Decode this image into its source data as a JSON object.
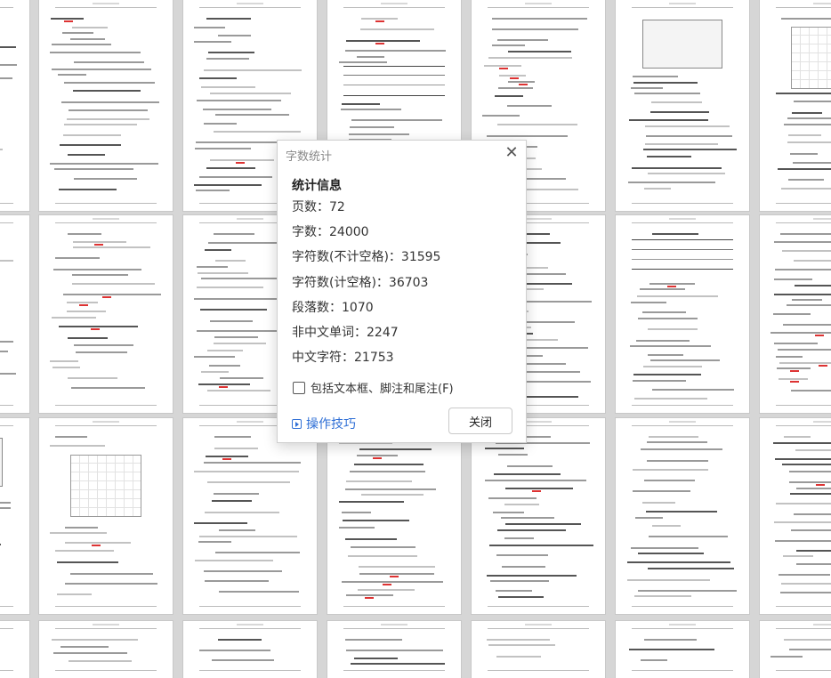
{
  "dialog": {
    "title": "字数统计",
    "section_title": "统计信息",
    "stats": {
      "pages": "页数：72",
      "words": "字数：24000",
      "chars_no_space": "字符数(不计空格)：31595",
      "chars_with_space": "字符数(计空格)：36703",
      "paragraphs": "段落数：1070",
      "non_chinese_words": "非中文单词：2247",
      "chinese_chars": "中文字符：21753"
    },
    "include_textbox_label": "包括文本框、脚注和尾注(F)",
    "include_textbox_checked": false,
    "tips_label": "操作技巧",
    "close_label": "关闭",
    "close_icon": "close-icon",
    "tips_icon": "play-square-icon"
  },
  "colors": {
    "background": "#d6d6d6",
    "link": "#2f6fd6",
    "dialog_title": "#888888"
  }
}
